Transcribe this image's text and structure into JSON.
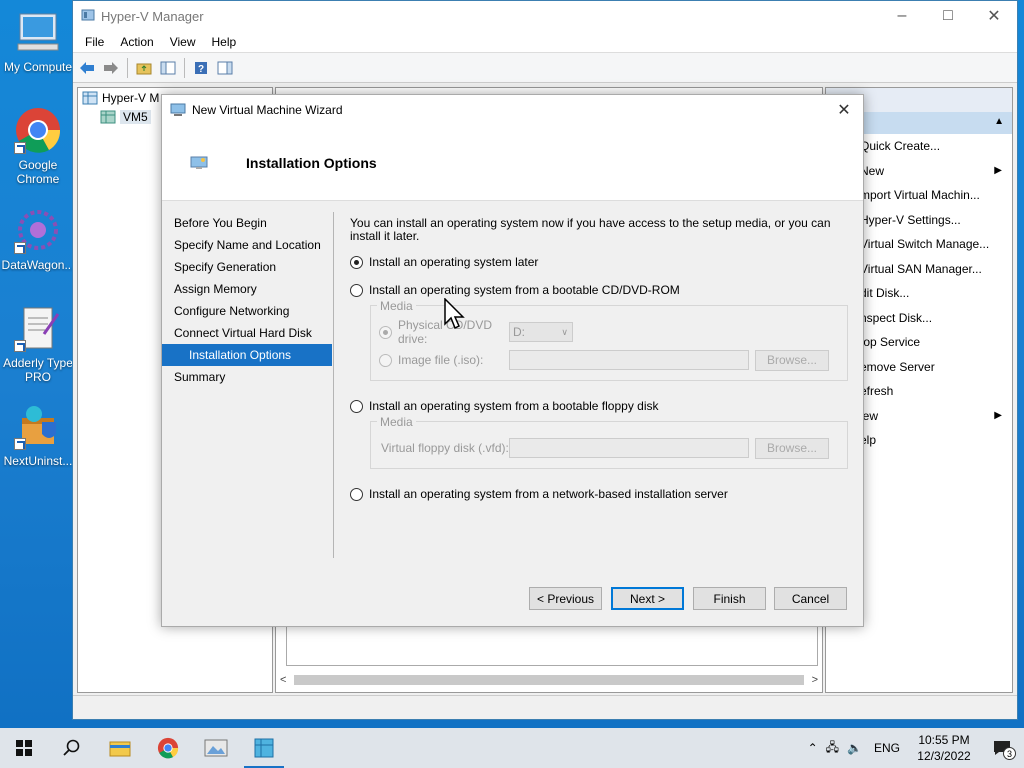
{
  "desktop": {
    "icons": [
      {
        "label": "My Compute"
      },
      {
        "label": "Google Chrome"
      },
      {
        "label": "DataWagon..."
      },
      {
        "label": "Adderly Type PRO"
      },
      {
        "label": "NextUninst..."
      }
    ]
  },
  "hyperv": {
    "title": "Hyper-V Manager",
    "menu": [
      "File",
      "Action",
      "View",
      "Help"
    ],
    "tree": {
      "root": "Hyper-V M",
      "child": "VM5"
    },
    "actions_header": "ns",
    "actions": [
      {
        "label": "Quick Create...",
        "arrow": ""
      },
      {
        "label": "New",
        "arrow": "▶"
      },
      {
        "label": "mport Virtual Machin...",
        "arrow": ""
      },
      {
        "label": "Hyper-V Settings...",
        "arrow": ""
      },
      {
        "label": "Virtual Switch Manage...",
        "arrow": ""
      },
      {
        "label": "Virtual SAN Manager...",
        "arrow": ""
      },
      {
        "label": "dit Disk...",
        "arrow": ""
      },
      {
        "label": "nspect Disk...",
        "arrow": ""
      },
      {
        "label": "top Service",
        "arrow": ""
      },
      {
        "label": "emove Server",
        "arrow": ""
      },
      {
        "label": "efresh",
        "arrow": ""
      },
      {
        "label": "iew",
        "arrow": "▶"
      },
      {
        "label": "elp",
        "arrow": ""
      }
    ]
  },
  "wizard": {
    "title": "New Virtual Machine Wizard",
    "heading": "Installation Options",
    "steps": [
      {
        "label": "Before You Begin",
        "active": false
      },
      {
        "label": "Specify Name and Location",
        "active": false
      },
      {
        "label": "Specify Generation",
        "active": false
      },
      {
        "label": "Assign Memory",
        "active": false
      },
      {
        "label": "Configure Networking",
        "active": false
      },
      {
        "label": "Connect Virtual Hard Disk",
        "active": false
      },
      {
        "label": "Installation Options",
        "active": true
      },
      {
        "label": "Summary",
        "active": false
      }
    ],
    "intro": "You can install an operating system now if you have access to the setup media, or you can install it later.",
    "options": {
      "later": "Install an operating system later",
      "cd": "Install an operating system from a bootable CD/DVD-ROM",
      "floppy": "Install an operating system from a bootable floppy disk",
      "network": "Install an operating system from a network-based installation server"
    },
    "selected_option": "later",
    "cd_group": {
      "legend": "Media",
      "physical_label": "Physical CD/DVD drive:",
      "physical_value": "D:",
      "image_label": "Image file (.iso):",
      "image_value": "",
      "browse": "Browse..."
    },
    "floppy_group": {
      "legend": "Media",
      "vfd_label": "Virtual floppy disk (.vfd):",
      "vfd_value": "",
      "browse": "Browse..."
    },
    "buttons": {
      "previous": "< Previous",
      "next": "Next >",
      "finish": "Finish",
      "cancel": "Cancel"
    }
  },
  "taskbar": {
    "language": "ENG",
    "time": "10:55 PM",
    "date": "12/3/2022",
    "notifications": "3"
  }
}
